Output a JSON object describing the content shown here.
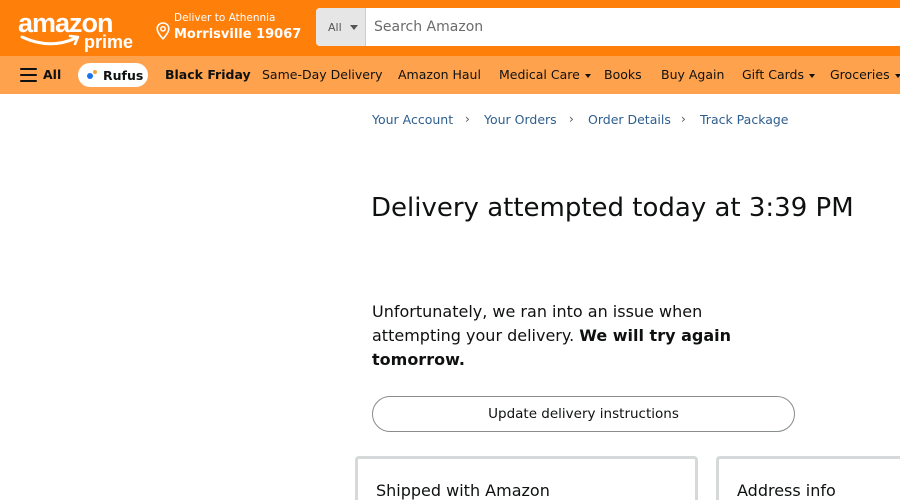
{
  "header": {
    "logo_word": "amazon",
    "logo_sub": "prime",
    "deliver_line1": "Deliver to Athennia",
    "deliver_line2": "Morrisville 19067",
    "search_scope": "All",
    "search_placeholder": "Search Amazon",
    "brand_color": "#ff7f0b"
  },
  "nav": {
    "all_label": "All",
    "rufus_label": "Rufus",
    "items": [
      "Black Friday",
      "Same-Day Delivery",
      "Amazon Haul",
      "Medical Care",
      "Books",
      "Buy Again",
      "Gift Cards",
      "Groceries"
    ],
    "nav_color": "#ffa24d"
  },
  "breadcrumb": {
    "items": [
      "Your Account",
      "Your Orders",
      "Order Details",
      "Track Package"
    ],
    "separator": "›"
  },
  "main": {
    "title": "Delivery attempted today at 3:39 PM",
    "message_plain": "Unfortunately, we ran into an issue when attempting your delivery.",
    "message_bold": "We will try again tomorrow.",
    "update_button": "Update delivery instructions",
    "card1_title": "Shipped with Amazon",
    "card2_title": "Address info"
  },
  "icons": {
    "location": "location-pin-icon",
    "menu": "hamburger-menu-icon",
    "rufus": "rufus-sparkle-icon",
    "dropdown": "chevron-down-icon"
  }
}
